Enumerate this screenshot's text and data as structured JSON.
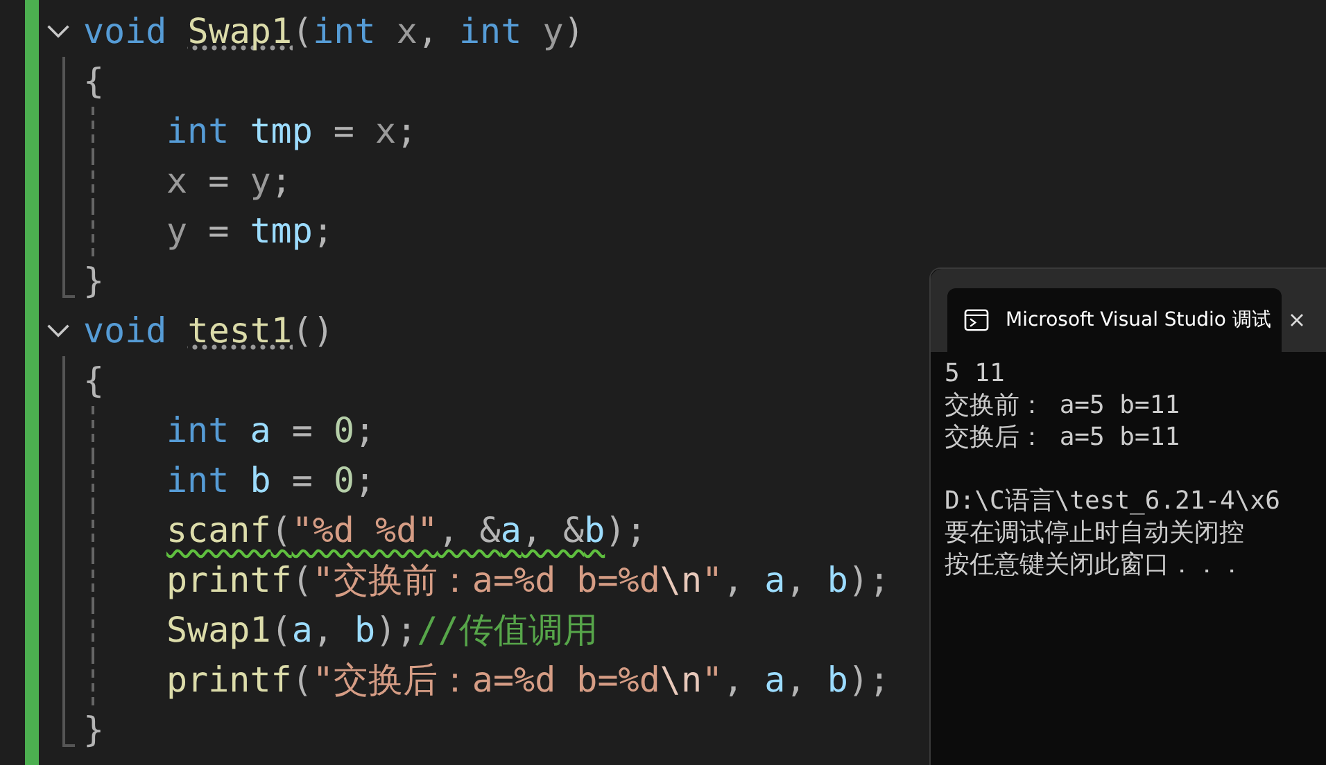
{
  "editor": {
    "lines": [
      {
        "kind": "header",
        "expanded": true,
        "tokens": [
          {
            "t": "void ",
            "kind": "kw"
          },
          {
            "t": "Swap1",
            "kind": "fn",
            "hint": true
          },
          {
            "t": "(",
            "kind": "p"
          },
          {
            "t": "int ",
            "kind": "kw"
          },
          {
            "t": "x",
            "kind": "param"
          },
          {
            "t": ", ",
            "kind": "p"
          },
          {
            "t": "int ",
            "kind": "kw"
          },
          {
            "t": "y",
            "kind": "param"
          },
          {
            "t": ")",
            "kind": "p"
          }
        ]
      },
      {
        "kind": "open",
        "tokens": [
          {
            "t": "{",
            "kind": "p"
          }
        ]
      },
      {
        "kind": "body",
        "tokens": [
          {
            "t": "int ",
            "kind": "kw"
          },
          {
            "t": "tmp",
            "kind": "var"
          },
          {
            "t": " = ",
            "kind": "p"
          },
          {
            "t": "x",
            "kind": "param"
          },
          {
            "t": ";",
            "kind": "p"
          }
        ]
      },
      {
        "kind": "body",
        "tokens": [
          {
            "t": "x",
            "kind": "param"
          },
          {
            "t": " = ",
            "kind": "p"
          },
          {
            "t": "y",
            "kind": "param"
          },
          {
            "t": ";",
            "kind": "p"
          }
        ]
      },
      {
        "kind": "body",
        "tokens": [
          {
            "t": "y",
            "kind": "param"
          },
          {
            "t": " = ",
            "kind": "p"
          },
          {
            "t": "tmp",
            "kind": "var"
          },
          {
            "t": ";",
            "kind": "p"
          }
        ]
      },
      {
        "kind": "close",
        "tokens": [
          {
            "t": "}",
            "kind": "p"
          }
        ]
      },
      {
        "kind": "header",
        "expanded": true,
        "tokens": [
          {
            "t": "void ",
            "kind": "kw"
          },
          {
            "t": "test1",
            "kind": "fn",
            "hint": true
          },
          {
            "t": "()",
            "kind": "p"
          }
        ]
      },
      {
        "kind": "open",
        "tokens": [
          {
            "t": "{",
            "kind": "p"
          }
        ]
      },
      {
        "kind": "body",
        "tokens": [
          {
            "t": "int ",
            "kind": "kw"
          },
          {
            "t": "a",
            "kind": "var"
          },
          {
            "t": " = ",
            "kind": "p"
          },
          {
            "t": "0",
            "kind": "num"
          },
          {
            "t": ";",
            "kind": "p"
          }
        ]
      },
      {
        "kind": "body",
        "tokens": [
          {
            "t": "int ",
            "kind": "kw"
          },
          {
            "t": "b",
            "kind": "var"
          },
          {
            "t": " = ",
            "kind": "p"
          },
          {
            "t": "0",
            "kind": "num"
          },
          {
            "t": ";",
            "kind": "p"
          }
        ]
      },
      {
        "kind": "body",
        "tokens": [
          {
            "t": "scanf",
            "kind": "fn",
            "squiggle": true
          },
          {
            "t": "(",
            "kind": "p",
            "squiggle": true
          },
          {
            "t": "\"%d %d\"",
            "kind": "str",
            "squiggle": true
          },
          {
            "t": ", &",
            "kind": "p",
            "squiggle": true
          },
          {
            "t": "a",
            "kind": "var",
            "squiggle": true
          },
          {
            "t": ", &",
            "kind": "p",
            "squiggle": true
          },
          {
            "t": "b",
            "kind": "var",
            "squiggle": true
          },
          {
            "t": ");",
            "kind": "p"
          }
        ]
      },
      {
        "kind": "body",
        "tokens": [
          {
            "t": "printf",
            "kind": "fn"
          },
          {
            "t": "(",
            "kind": "p"
          },
          {
            "t": "\"交换前：a=%d b=%d",
            "kind": "str"
          },
          {
            "t": "\\n",
            "kind": "esc"
          },
          {
            "t": "\"",
            "kind": "str"
          },
          {
            "t": ", ",
            "kind": "p"
          },
          {
            "t": "a",
            "kind": "var"
          },
          {
            "t": ", ",
            "kind": "p"
          },
          {
            "t": "b",
            "kind": "var"
          },
          {
            "t": ");",
            "kind": "p"
          }
        ]
      },
      {
        "kind": "body",
        "tokens": [
          {
            "t": "Swap1",
            "kind": "fn"
          },
          {
            "t": "(",
            "kind": "p"
          },
          {
            "t": "a",
            "kind": "var"
          },
          {
            "t": ", ",
            "kind": "p"
          },
          {
            "t": "b",
            "kind": "var"
          },
          {
            "t": ");",
            "kind": "p"
          },
          {
            "t": "//传值调用",
            "kind": "cmt"
          }
        ]
      },
      {
        "kind": "body",
        "tokens": [
          {
            "t": "printf",
            "kind": "fn"
          },
          {
            "t": "(",
            "kind": "p"
          },
          {
            "t": "\"交换后：a=%d b=%d",
            "kind": "str"
          },
          {
            "t": "\\n",
            "kind": "esc"
          },
          {
            "t": "\"",
            "kind": "str"
          },
          {
            "t": ", ",
            "kind": "p"
          },
          {
            "t": "a",
            "kind": "var"
          },
          {
            "t": ", ",
            "kind": "p"
          },
          {
            "t": "b",
            "kind": "var"
          },
          {
            "t": ");",
            "kind": "p"
          }
        ]
      },
      {
        "kind": "close",
        "tokens": [
          {
            "t": "}",
            "kind": "p"
          }
        ]
      }
    ]
  },
  "console": {
    "title": "Microsoft Visual Studio 调试",
    "output": [
      "5 11",
      "交换前： a=5 b=11",
      "交换后： a=5 b=11"
    ],
    "prompt": [
      "D:\\C语言\\test_6.21-4\\x6",
      "要在调试停止时自动关闭控",
      "按任意键关闭此窗口．．．"
    ]
  }
}
